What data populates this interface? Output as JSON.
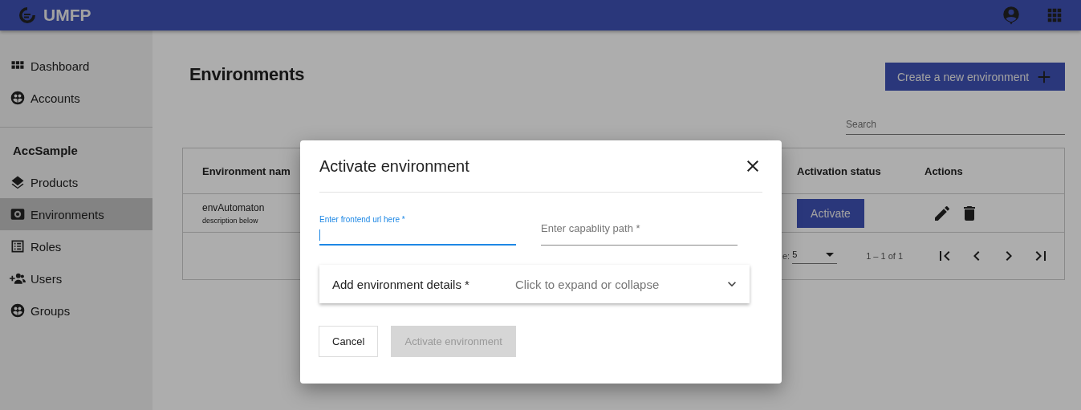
{
  "app": {
    "title": "UMFP"
  },
  "sidebar": {
    "items": [
      {
        "label": "Dashboard",
        "selected": false
      },
      {
        "label": "Accounts",
        "selected": false
      }
    ],
    "section_title": "AccSample",
    "section_items": [
      {
        "label": "Products",
        "selected": false
      },
      {
        "label": "Environments",
        "selected": true
      },
      {
        "label": "Roles",
        "selected": false
      },
      {
        "label": "Users",
        "selected": false
      },
      {
        "label": "Groups",
        "selected": false
      }
    ]
  },
  "page": {
    "title": "Environments",
    "create_button": "Create a new environment",
    "search": {
      "placeholder": "Search"
    }
  },
  "table": {
    "columns": [
      "Environment nam",
      "Activation status",
      "Actions"
    ],
    "rows": [
      {
        "name": "envAutomaton",
        "description": "description below",
        "action": "Activate"
      }
    ],
    "paginator": {
      "label_fragment": "e:",
      "page_size": "5",
      "range": "1 – 1 of 1"
    }
  },
  "dialog": {
    "title": "Activate environment",
    "fields": [
      {
        "label": "Enter frontend url here *",
        "focused": true
      },
      {
        "placeholder": "Enter capablity path *",
        "focused": false
      }
    ],
    "panel": {
      "title": "Add environment details *",
      "hint": "Click to expand or collapse",
      "expanded": false
    },
    "buttons": [
      {
        "label": "Cancel",
        "disabled": false
      },
      {
        "label": "Activate environment",
        "disabled": true
      }
    ]
  }
}
